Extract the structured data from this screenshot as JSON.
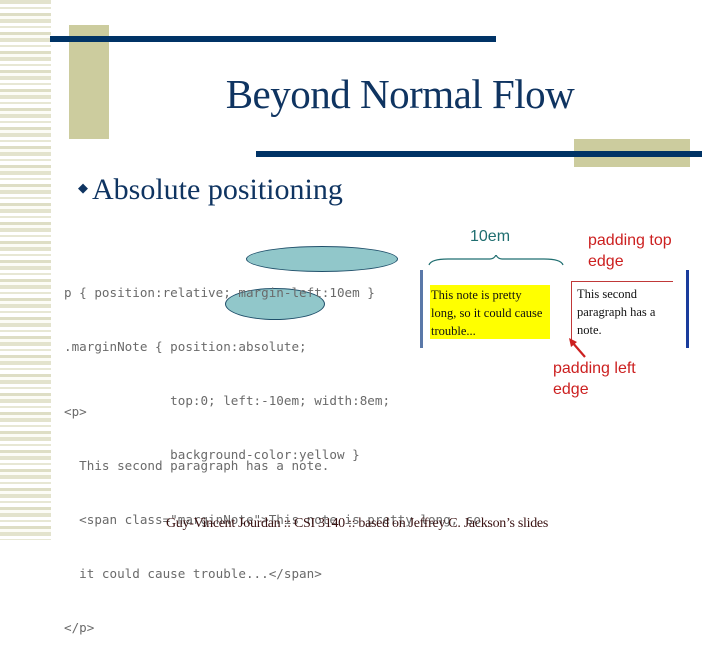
{
  "slide": {
    "title": "Beyond Normal Flow",
    "bullet": {
      "icon": "diamond-bullet-icon",
      "glyph": "◆",
      "text": "Absolute positioning"
    },
    "css_code": {
      "lines": [
        "p { position:relative; margin-left:10em }",
        ".marginNote { position:absolute;",
        "              top:0; left:-10em; width:8em;",
        "              background-color:yellow }"
      ],
      "highlighted": [
        "margin-left:10em",
        "left:-10em"
      ]
    },
    "html_code": {
      "lines": [
        "<p>",
        "  This second paragraph has a note.",
        "  <span class=\"marginNote\">This note is pretty long, so",
        "  it could cause trouble...</span>",
        "</p>"
      ]
    },
    "diagram": {
      "width_label": "10em",
      "note_text": "This note is pretty long, so it could cause trouble...",
      "paragraph_text": "This second paragraph has a note.",
      "padding_top_label": [
        "padding top",
        "edge"
      ],
      "padding_left_label": [
        "padding left",
        "edge"
      ]
    },
    "footer": "Guy-Vincent Jourdan :: CSI 3140 :: based on Jeffrey C. Jackson’s slides"
  },
  "colors": {
    "title": "#0f3461",
    "rule": "#003366",
    "olive": "#cccc9e",
    "highlight_oval": "#66b2b5",
    "note_bg": "#ffff00",
    "annotation_red": "#cc2020",
    "annotation_teal": "#1f6e70"
  }
}
